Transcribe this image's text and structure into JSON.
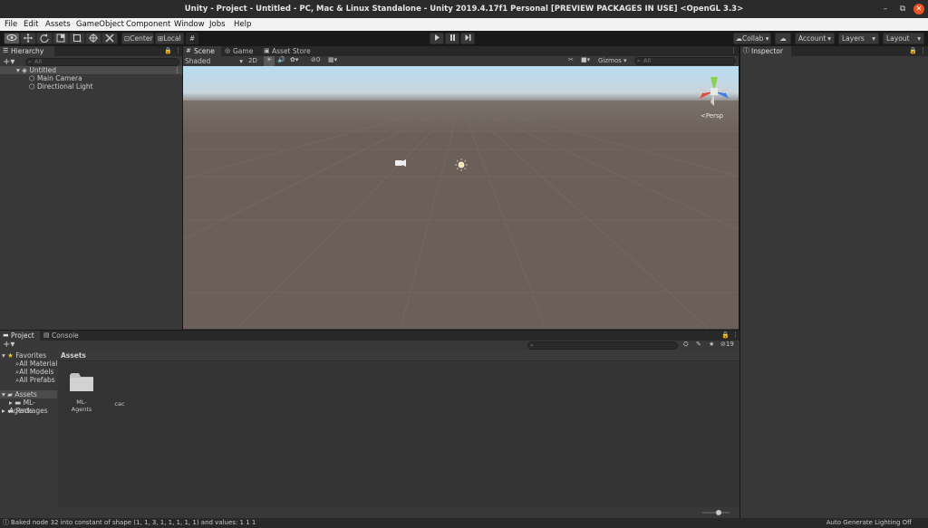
{
  "window": {
    "title": "Unity - Project - Untitled - PC, Mac & Linux Standalone - Unity 2019.4.17f1 Personal [PREVIEW PACKAGES IN USE] <OpenGL 3.3>",
    "controls": {
      "minimize": "–",
      "maximize": "⧉",
      "close": "✕"
    }
  },
  "menu": [
    "File",
    "Edit",
    "Assets",
    "GameObject",
    "Component",
    "Window",
    "Jobs",
    "Help"
  ],
  "toolbar": {
    "pivot_label": "Center",
    "space_label": "Local",
    "collab_label": "Collab ▾",
    "account_label": "Account",
    "layers_label": "Layers",
    "layout_label": "Layout"
  },
  "hierarchy": {
    "tab_label": "Hierarchy",
    "search_placeholder": "All",
    "scene_name": "Untitled",
    "items": [
      "Main Camera",
      "Directional Light"
    ]
  },
  "scene": {
    "tabs": [
      "Scene",
      "Game",
      "Asset Store"
    ],
    "shading_mode": "Shaded",
    "mode_2d": "2D",
    "gizmos_label": "Gizmos",
    "search_placeholder": "All",
    "fx_count": "0",
    "projection_label": "Persp"
  },
  "inspector": {
    "tab_label": "Inspector"
  },
  "project": {
    "tabs": [
      "Project",
      "Console"
    ],
    "hidden_count": "19",
    "favorites_label": "Favorites",
    "favorites": [
      "All Materials",
      "All Models",
      "All Prefabs"
    ],
    "assets_label": "Assets",
    "asset_children": [
      "ML-Agents"
    ],
    "packages_label": "Packages",
    "breadcrumb": "Assets",
    "grid_items": [
      "ML-Agents",
      "cac"
    ]
  },
  "status": {
    "message": "Baked node 32 into constant of shape (1, 1, 3, 1, 1, 1, 1, 1) and values: 1 1 1",
    "lighting": "Auto Generate Lighting Off"
  },
  "colors": {
    "background": "#191919",
    "panel": "#383838",
    "titlebar": "#2b2b2b",
    "close_button": "#e95420",
    "ground": "#6b6059",
    "sky_top": "#b8dcf2"
  }
}
